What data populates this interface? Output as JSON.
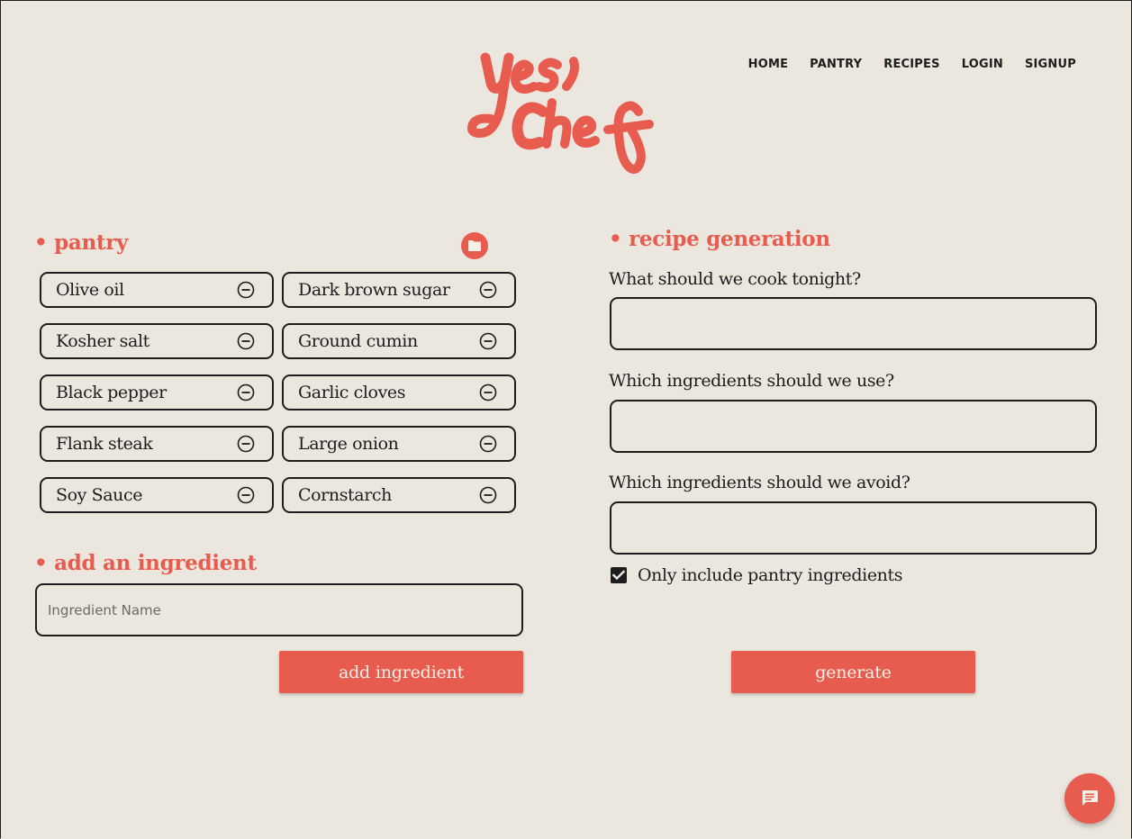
{
  "brand": {
    "logo_text_line1": "Yes,",
    "logo_text_line2": "Chef",
    "color": "#e85c50"
  },
  "nav": {
    "items": [
      "HOME",
      "PANTRY",
      "RECIPES",
      "LOGIN",
      "SIGNUP"
    ]
  },
  "pantry": {
    "title": "• pantry",
    "folder_icon": "folder-icon",
    "items": [
      "Olive oil",
      "Dark brown sugar",
      "Kosher salt",
      "Ground cumin",
      "Black pepper",
      "Garlic cloves",
      "Flank steak",
      "Large onion",
      "Soy Sauce",
      "Cornstarch"
    ],
    "remove_icon": "minus-circle-icon"
  },
  "add_ingredient": {
    "title": "• add an ingredient",
    "input_placeholder": "Ingredient Name",
    "input_value": "",
    "button_label": "add ingredient"
  },
  "recipe_generation": {
    "title": "• recipe generation",
    "fields": [
      {
        "label": "What should we cook tonight?",
        "value": ""
      },
      {
        "label": "Which ingredients should we use?",
        "value": ""
      },
      {
        "label": "Which ingredients should we avoid?",
        "value": ""
      }
    ],
    "checkbox_label": "Only include pantry ingredients",
    "checkbox_checked": true,
    "button_label": "generate"
  },
  "chat": {
    "icon": "chat-icon"
  }
}
